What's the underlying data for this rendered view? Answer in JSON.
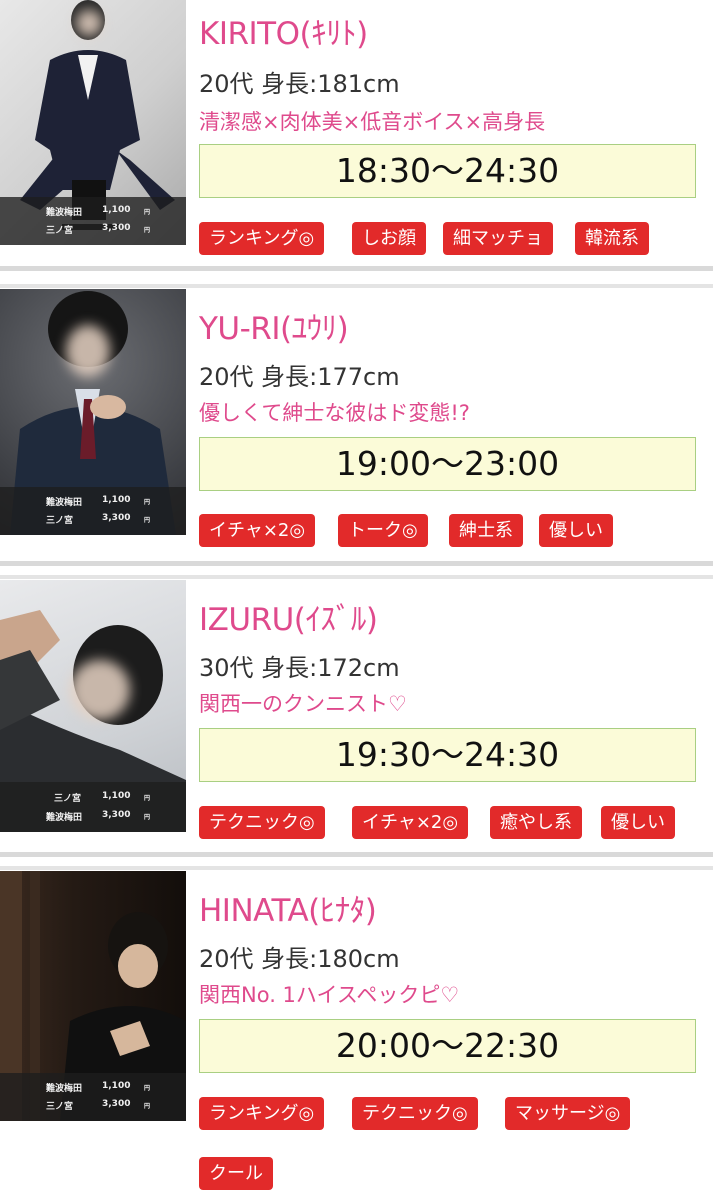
{
  "cards": [
    {
      "name": "KIRITO(ｷﾘﾄ)",
      "stats": "20代 身長:181cm",
      "catch": "清潔感×肉体美×低音ボイス×高身長",
      "hours": "18:30〜24:30",
      "tags": [
        "ランキング◎",
        "しお顔",
        "細マッチョ",
        "韓流系"
      ],
      "prices": [
        {
          "area": "難波梅田",
          "amount": "1,100",
          "unit": "円"
        },
        {
          "area": "三ノ宮",
          "amount": "3,300",
          "unit": "円"
        }
      ]
    },
    {
      "name": "YU-RI(ﾕｳﾘ)",
      "stats": "20代 身長:177cm",
      "catch": "優しくて紳士な彼はド変態!?",
      "hours": "19:00〜23:00",
      "tags": [
        "イチャ×2◎",
        "トーク◎",
        "紳士系",
        "優しい"
      ],
      "prices": [
        {
          "area": "難波梅田",
          "amount": "1,100",
          "unit": "円"
        },
        {
          "area": "三ノ宮",
          "amount": "3,300",
          "unit": "円"
        }
      ]
    },
    {
      "name": "IZURU(ｲｽﾞﾙ)",
      "stats": "30代 身長:172cm",
      "catch": "関西一のクンニスト♡",
      "hours": "19:30〜24:30",
      "tags": [
        "テクニック◎",
        "イチャ×2◎",
        "癒やし系",
        "優しい"
      ],
      "prices": [
        {
          "area": "三ノ宮",
          "amount": "1,100",
          "unit": "円"
        },
        {
          "area": "難波梅田",
          "amount": "3,300",
          "unit": "円"
        }
      ]
    },
    {
      "name": "HINATA(ﾋﾅﾀ)",
      "stats": "20代 身長:180cm",
      "catch": "関西No. 1ハイスペックピ♡",
      "hours": "20:00〜22:30",
      "tags": [
        "ランキング◎",
        "テクニック◎",
        "マッサージ◎",
        "クール"
      ],
      "prices": [
        {
          "area": "難波梅田",
          "amount": "1,100",
          "unit": "円"
        },
        {
          "area": "三ノ宮",
          "amount": "3,300",
          "unit": "円"
        }
      ]
    }
  ]
}
